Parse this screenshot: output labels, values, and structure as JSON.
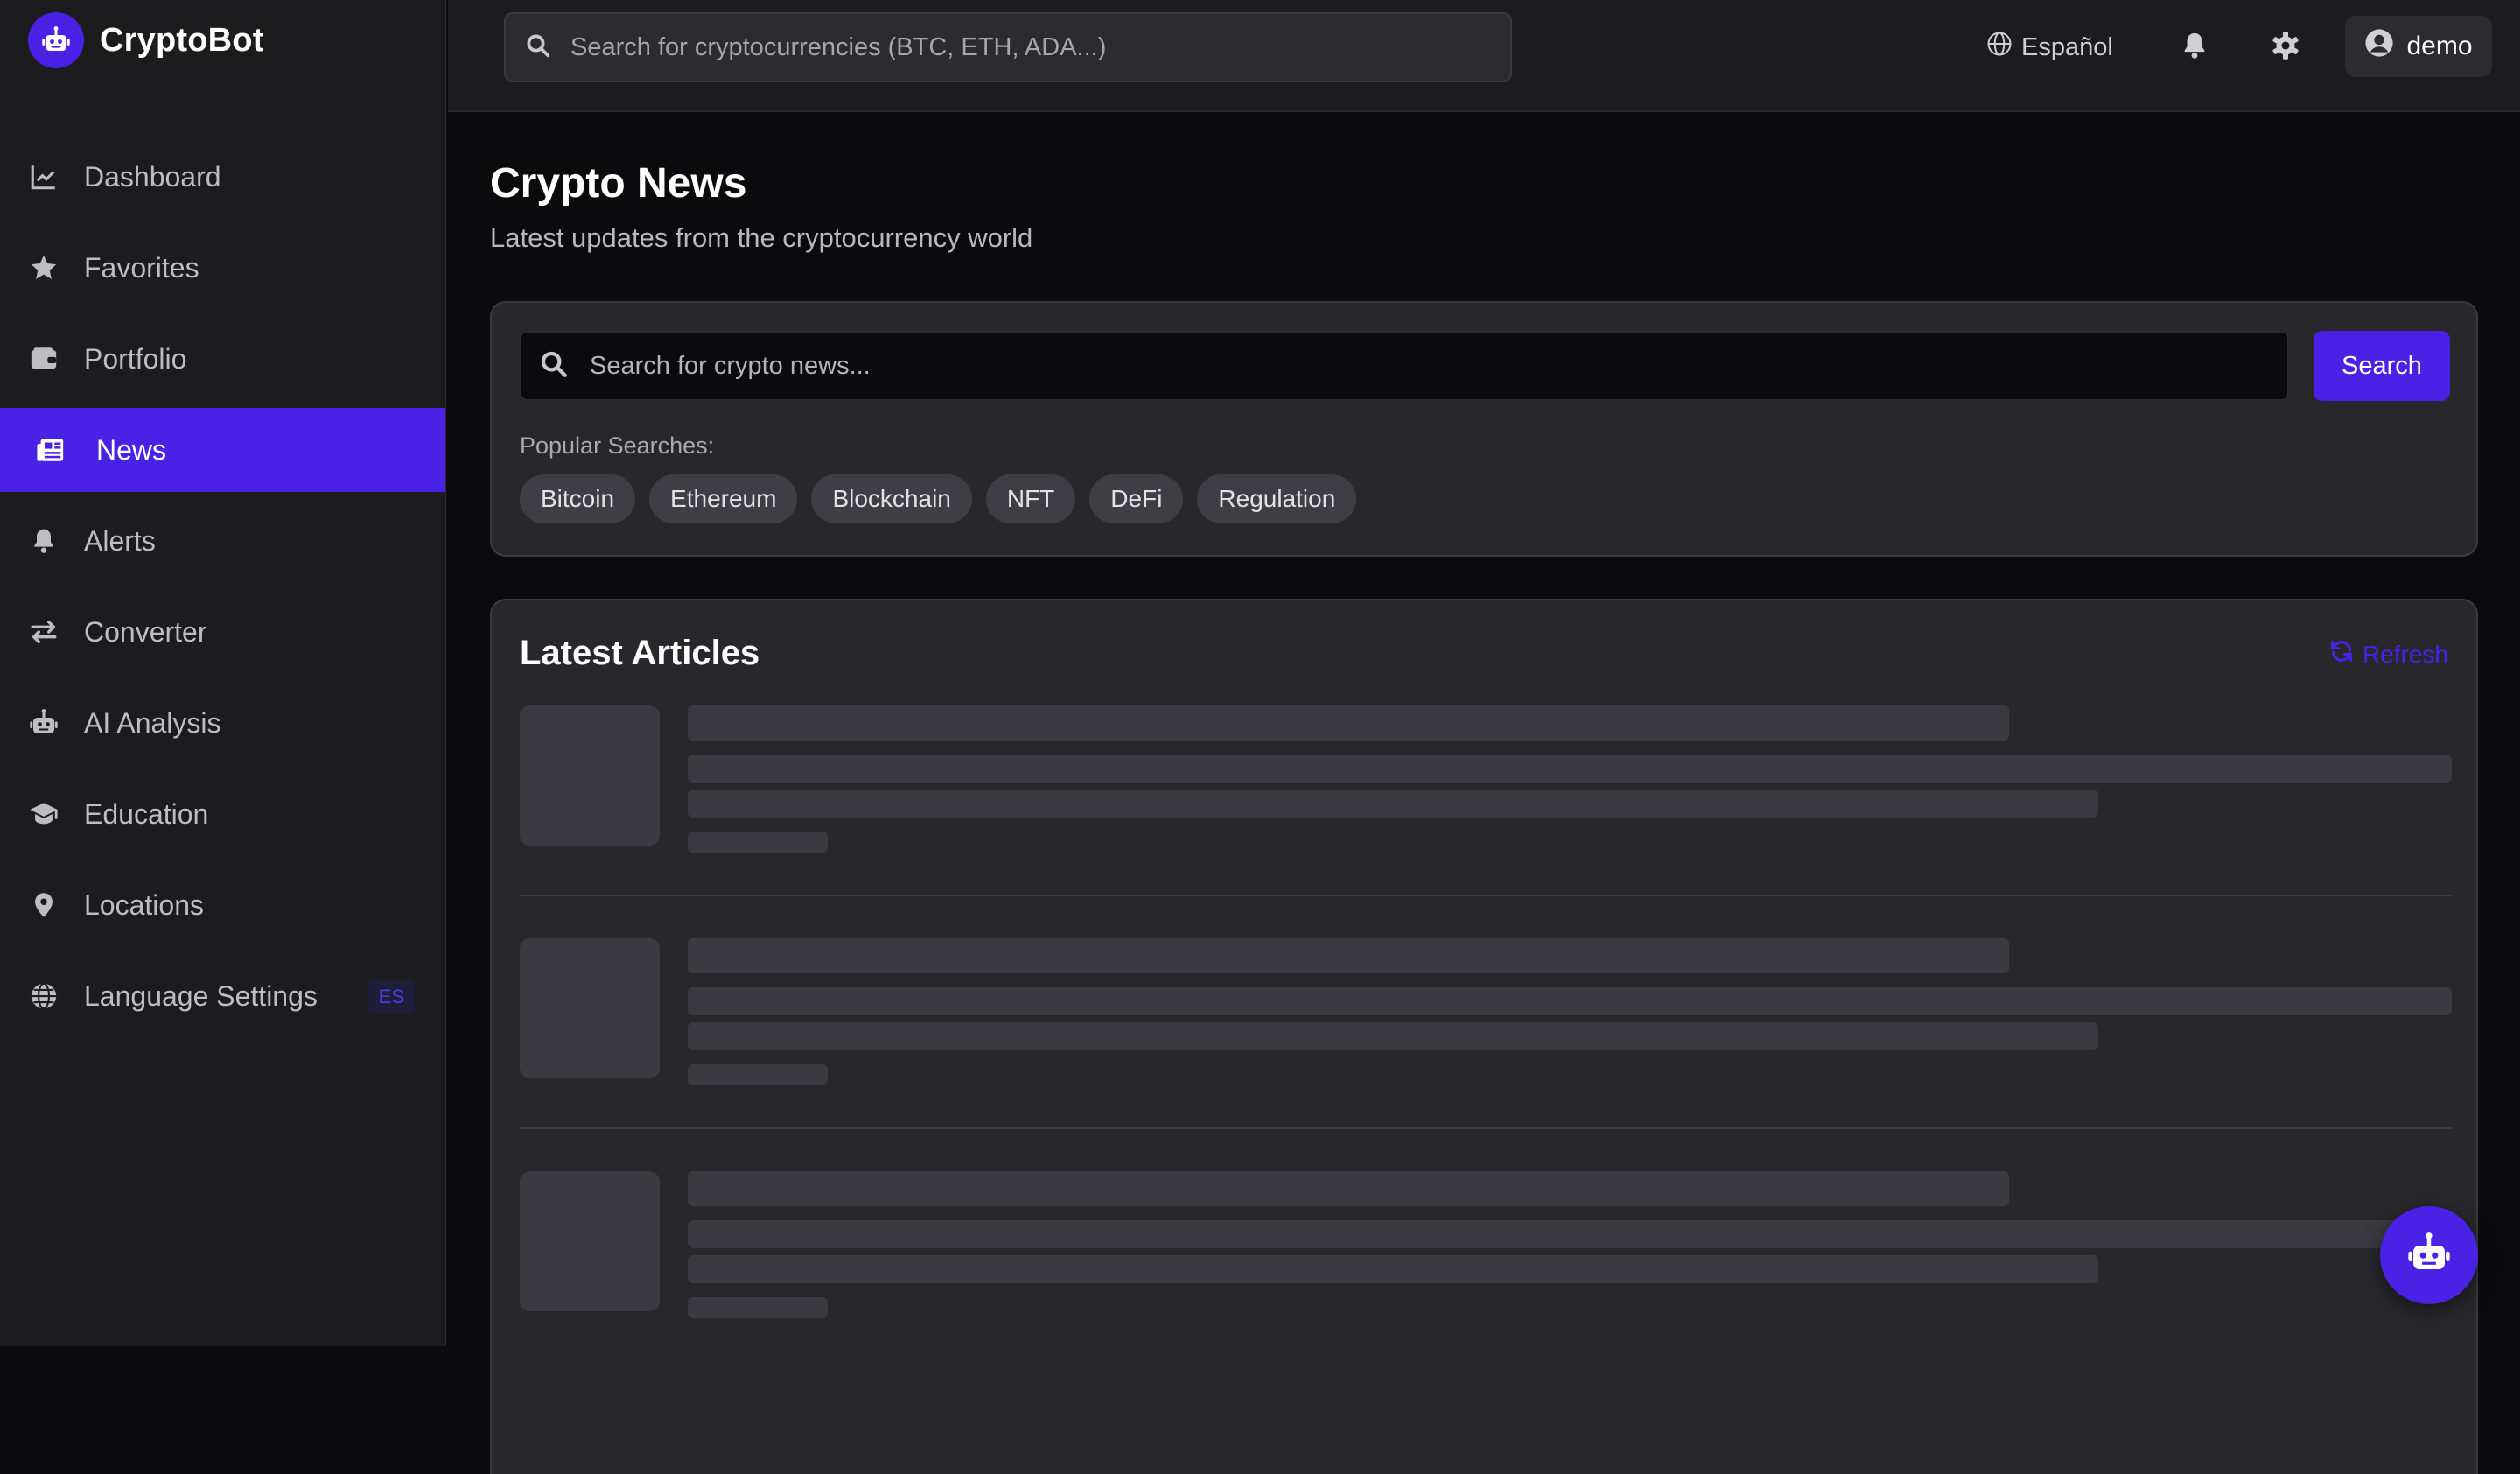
{
  "app": {
    "name": "CryptoBot"
  },
  "sidebar": {
    "items": [
      {
        "label": "Dashboard",
        "icon": "chart-line-icon"
      },
      {
        "label": "Favorites",
        "icon": "star-icon"
      },
      {
        "label": "Portfolio",
        "icon": "wallet-icon"
      },
      {
        "label": "News",
        "icon": "newspaper-icon",
        "active": true
      },
      {
        "label": "Alerts",
        "icon": "bell-icon"
      },
      {
        "label": "Converter",
        "icon": "exchange-icon"
      },
      {
        "label": "AI Analysis",
        "icon": "robot-icon"
      },
      {
        "label": "Education",
        "icon": "graduation-cap-icon"
      },
      {
        "label": "Locations",
        "icon": "map-pin-icon"
      },
      {
        "label": "Language Settings",
        "icon": "globe-icon",
        "badge": "ES"
      }
    ]
  },
  "topbar": {
    "search_placeholder": "Search for cryptocurrencies (BTC, ETH, ADA...)",
    "language_label": "Español",
    "user_label": "demo"
  },
  "page": {
    "title": "Crypto News",
    "subtitle": "Latest updates from the cryptocurrency world"
  },
  "news_search": {
    "placeholder": "Search for crypto news...",
    "button_label": "Search",
    "popular_label": "Popular Searches:",
    "tags": [
      "Bitcoin",
      "Ethereum",
      "Blockchain",
      "NFT",
      "DeFi",
      "Regulation"
    ]
  },
  "articles": {
    "title": "Latest Articles",
    "refresh_label": "Refresh"
  },
  "colors": {
    "accent": "#4a22e6",
    "background": "#0b0b0d",
    "panel": "#1c1c1f",
    "card": "#28282c",
    "skeleton": "#3a3a40"
  }
}
